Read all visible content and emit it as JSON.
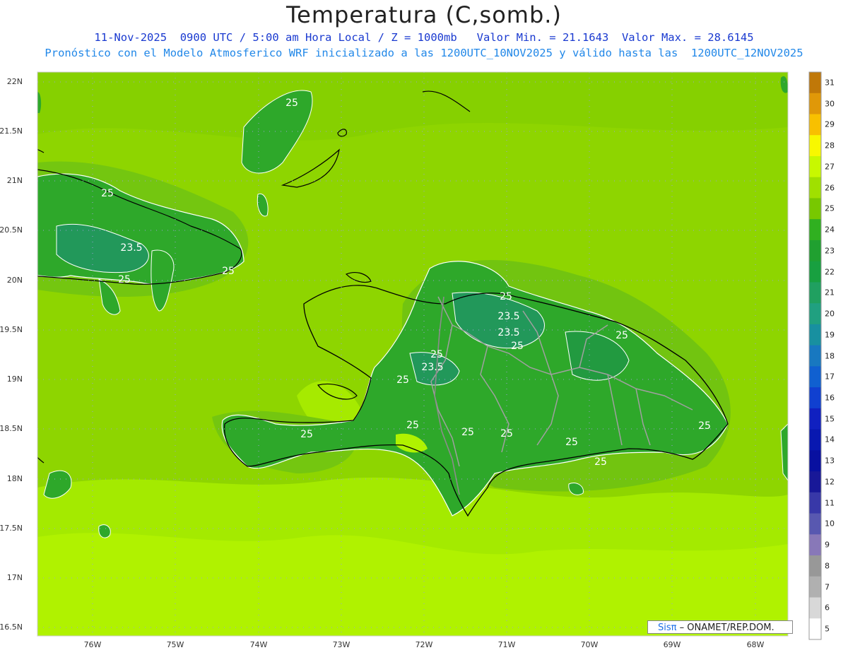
{
  "title": "Temperatura (C,somb.)",
  "subtitle_line1": "11-Nov-2025  0900 UTC / 5:00 am Hora Local / Z = 1000mb   Valor Min. = 21.1643  Valor Max. = 28.6145",
  "subtitle_line2": "Pronóstico con el Modelo Atmosferico WRF inicializado a las 1200UTC_10NOV2025 y válido hasta las  1200UTC_12NOV2025",
  "lat_ticks": [
    "22N",
    "21.5N",
    "21N",
    "20.5N",
    "20N",
    "19.5N",
    "19N",
    "18.5N",
    "18N",
    "17.5N",
    "17N",
    "16.5N"
  ],
  "lon_ticks": [
    "76W",
    "75W",
    "74W",
    "73W",
    "72W",
    "71W",
    "70W",
    "69W",
    "68W"
  ],
  "colorbar": {
    "labels": [
      "31",
      "30",
      "29",
      "28",
      "27",
      "26",
      "25",
      "24",
      "23",
      "22",
      "21",
      "20",
      "19",
      "18",
      "17",
      "16",
      "15",
      "14",
      "13",
      "12",
      "11",
      "10",
      "9",
      "8",
      "7",
      "6",
      "5"
    ],
    "colors": [
      "#c07808",
      "#e09808",
      "#f8c000",
      "#f8f800",
      "#c8f800",
      "#a0e000",
      "#78c800",
      "#30b020",
      "#20a030",
      "#18a040",
      "#20a060",
      "#20a080",
      "#1890a0",
      "#1878c0",
      "#1060d0",
      "#1040d0",
      "#1020c0",
      "#0818b0",
      "#0810a0",
      "#181898",
      "#3838a8",
      "#5858b0",
      "#8878b8",
      "#989898",
      "#b0b0b0",
      "#d8d8d8",
      "#ffffff"
    ]
  },
  "contour_labels": [
    "25",
    "25",
    "23.5",
    "25",
    "25",
    "25",
    "23.5",
    "23.5",
    "25",
    "25",
    "25",
    "23.5",
    "25",
    "25",
    "25",
    "25",
    "25",
    "25",
    "25",
    "25"
  ],
  "credit": {
    "brand": "Sisπ",
    "text": "– ONAMET/REP.DOM."
  },
  "colors": {
    "sea": "#8ed500",
    "land": "#2ea82a",
    "warm": "#aef200",
    "cool": "#60b818"
  }
}
